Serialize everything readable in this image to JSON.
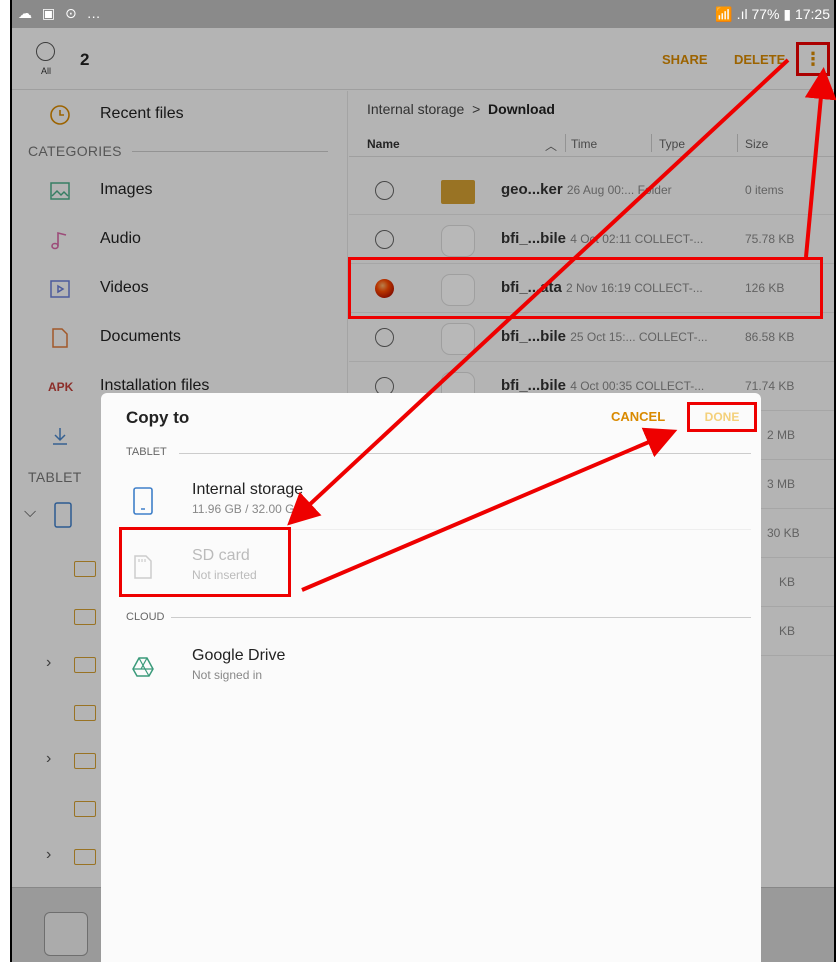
{
  "status": {
    "left_icons": "☁ ▣ ⊙ …",
    "right_text": "📶 .ıl 77% ▮ 17:25"
  },
  "appbar": {
    "select_all_label": "All",
    "selected_count": "2",
    "share": "SHARE",
    "delete": "DELETE",
    "more_icon": "⋮"
  },
  "sidebar": {
    "recent": "Recent files",
    "categories_header": "CATEGORIES",
    "categories": [
      {
        "label": "Images",
        "icon": "image-icon"
      },
      {
        "label": "Audio",
        "icon": "music-note-icon"
      },
      {
        "label": "Videos",
        "icon": "video-icon"
      },
      {
        "label": "Documents",
        "icon": "document-icon"
      },
      {
        "label": "Installation files",
        "icon": "apk-icon",
        "badge": "APK"
      },
      {
        "label": "",
        "icon": "download-icon"
      }
    ],
    "tablet_header": "TABLET"
  },
  "content": {
    "breadcrumb_root": "Internal storage",
    "breadcrumb_sep": ">",
    "breadcrumb_current": "Download",
    "columns": {
      "name": "Name",
      "sort": "︿",
      "time": "Time",
      "type": "Type",
      "size": "Size"
    },
    "rows": [
      {
        "name": "geo...ker",
        "meta": "26 Aug 00:... Folder",
        "size": "0 items",
        "kind": "folder",
        "selected": false
      },
      {
        "name": "bfi_...bile",
        "meta": "4 Oct 02:11 COLLECT-...",
        "size": "75.78 KB",
        "kind": "file",
        "selected": false
      },
      {
        "name": "bfi_...ata",
        "meta": "2 Nov 16:19 COLLECT-...",
        "size": "126 KB",
        "kind": "file",
        "selected": true
      },
      {
        "name": "bfi_...bile",
        "meta": "25 Oct 15:... COLLECT-...",
        "size": "86.58 KB",
        "kind": "file",
        "selected": false
      },
      {
        "name": "bfi_...bile",
        "meta": "4 Oct 00:35 COLLECT-...",
        "size": "71.74 KB",
        "kind": "file",
        "selected": false
      }
    ],
    "partial_sizes": [
      "2 MB",
      "3 MB",
      "30 KB",
      "KB",
      "KB"
    ]
  },
  "dialog": {
    "title": "Copy to",
    "cancel": "CANCEL",
    "done": "DONE",
    "section_tablet": "TABLET",
    "section_cloud": "CLOUD",
    "internal": {
      "title": "Internal storage",
      "subtitle": "11.96 GB / 32.00 GB"
    },
    "sdcard": {
      "title": "SD card",
      "subtitle": "Not inserted"
    },
    "gdrive": {
      "title": "Google Drive",
      "subtitle": "Not signed in"
    }
  },
  "colors": {
    "accent": "#d98a00",
    "folder": "#d4a032",
    "annotation": "#ee0000"
  }
}
